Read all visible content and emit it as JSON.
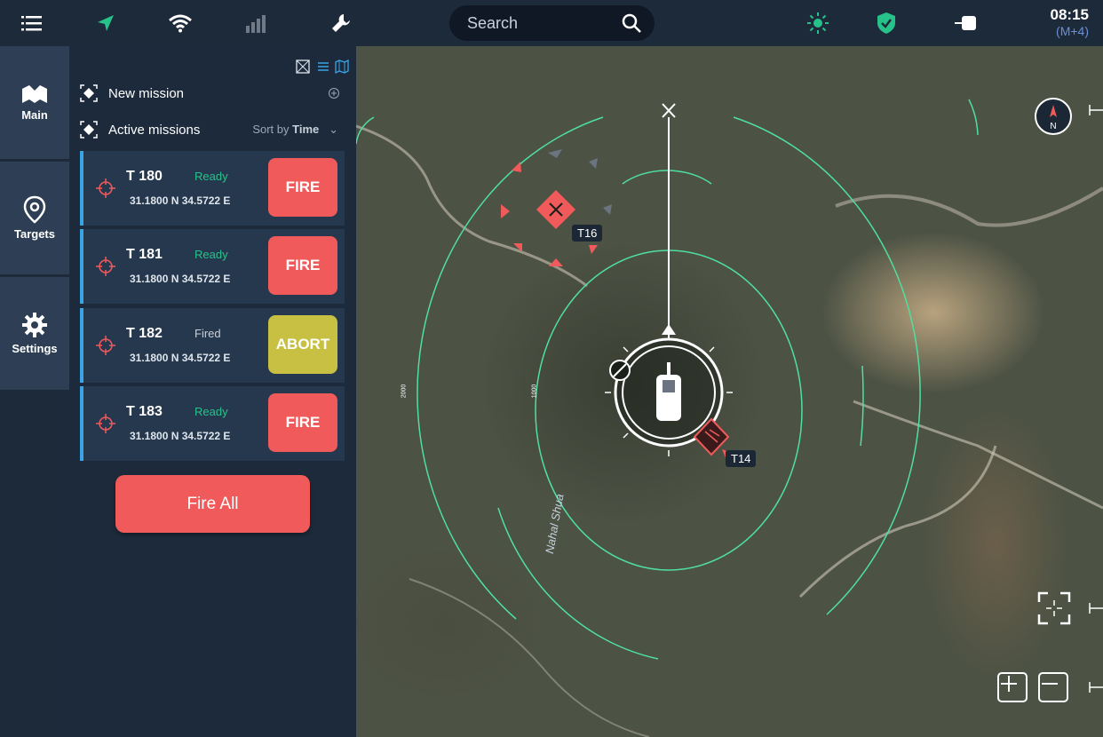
{
  "topbar": {
    "search_placeholder": "Search",
    "clock": {
      "time": "08:15",
      "tz": "(M+4)"
    },
    "icons": [
      "menu-icon",
      "location-arrow-icon",
      "wifi-icon",
      "signal-icon",
      "wrench-icon",
      "brightness-icon",
      "shield-check-icon",
      "toggle-icon"
    ],
    "colors": {
      "accent": "#27c28a",
      "tz": "#6b8fd6"
    }
  },
  "nav": {
    "items": [
      {
        "label": "Main",
        "icon": "map-icon"
      },
      {
        "label": "Targets",
        "icon": "pin-icon"
      },
      {
        "label": "Settings",
        "icon": "gear-icon"
      }
    ]
  },
  "panel": {
    "new_mission": "New mission",
    "active_missions": "Active missions",
    "sort_by_label": "Sort by",
    "sort_by_value": "Time",
    "missions": [
      {
        "name": "T 180",
        "status": "Ready",
        "coord": "31.1800 N 34.5722 E",
        "action": "FIRE"
      },
      {
        "name": "T 181",
        "status": "Ready",
        "coord": "31.1800 N 34.5722 E",
        "action": "FIRE"
      },
      {
        "name": "T 182",
        "status": "Fired",
        "coord": "31.1800 N 34.5722 E",
        "action": "ABORT"
      },
      {
        "name": "T 183",
        "status": "Ready",
        "coord": "31.1800 N 34.5722 E",
        "action": "FIRE"
      }
    ],
    "fire_all": "Fire All",
    "colors": {
      "fire": "#f05a5a",
      "abort": "#c7c042",
      "ready": "#27c28a",
      "fired": "#c8d0da"
    }
  },
  "map": {
    "labels": {
      "t16": "T16",
      "t14": "T14",
      "river": "Nahal Shua",
      "range_2000": "2000",
      "range_1000": "1000",
      "compass": "N"
    }
  }
}
